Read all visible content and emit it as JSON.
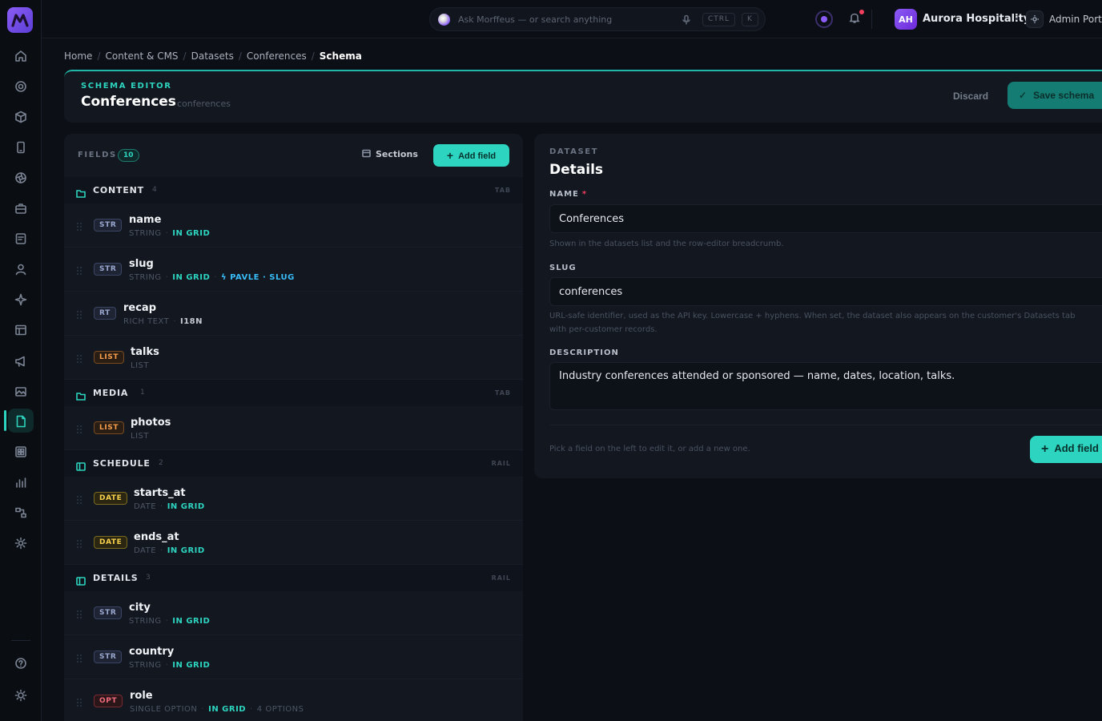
{
  "topbar": {
    "search_placeholder": "Ask Morffeus — or search anything",
    "kbd_ctrl": "CTRL",
    "kbd_k": "K",
    "avatar_initials": "AH",
    "org_name": "Aurora Hospitality",
    "portal_label": "Admin Portal"
  },
  "breadcrumb": [
    "Home",
    "Content & CMS",
    "Datasets",
    "Conferences",
    "Schema"
  ],
  "header": {
    "eyebrow": "SCHEMA EDITOR",
    "title": "Conferences",
    "slug": "conferences",
    "discard_label": "Discard",
    "save_label": "Save schema"
  },
  "fields_panel": {
    "label": "FIELDS",
    "count": "10",
    "sections_label": "Sections",
    "add_label": "Add field",
    "sections": [
      {
        "name": "CONTENT",
        "count": "4",
        "kind": "TAB",
        "fields": [
          {
            "badge": "STR",
            "name": "name",
            "type": "STRING",
            "flags": [
              "IN GRID"
            ]
          },
          {
            "badge": "STR",
            "name": "slug",
            "type": "STRING",
            "flags": [
              "IN GRID",
              "PAVLE · SLUG"
            ]
          },
          {
            "badge": "RT",
            "name": "recap",
            "type": "RICH TEXT",
            "flags": [
              "I18N"
            ]
          },
          {
            "badge": "LIST",
            "name": "talks",
            "type": "LIST",
            "flags": []
          }
        ]
      },
      {
        "name": "MEDIA",
        "count": "1",
        "kind": "TAB",
        "fields": [
          {
            "badge": "LIST",
            "name": "photos",
            "type": "LIST",
            "flags": []
          }
        ]
      },
      {
        "name": "SCHEDULE",
        "count": "2",
        "kind": "RAIL",
        "fields": [
          {
            "badge": "DATE",
            "name": "starts_at",
            "type": "DATE",
            "flags": [
              "IN GRID"
            ]
          },
          {
            "badge": "DATE",
            "name": "ends_at",
            "type": "DATE",
            "flags": [
              "IN GRID"
            ]
          }
        ]
      },
      {
        "name": "DETAILS",
        "count": "3",
        "kind": "RAIL",
        "fields": [
          {
            "badge": "STR",
            "name": "city",
            "type": "STRING",
            "flags": [
              "IN GRID"
            ]
          },
          {
            "badge": "STR",
            "name": "country",
            "type": "STRING",
            "flags": [
              "IN GRID"
            ]
          },
          {
            "badge": "OPT",
            "name": "role",
            "type": "SINGLE OPTION",
            "flags": [
              "IN GRID",
              "4 OPTIONS"
            ]
          }
        ]
      }
    ]
  },
  "details": {
    "eyebrow": "DATASET",
    "title": "Details",
    "name_label": "NAME",
    "name_value": "Conferences",
    "name_help": "Shown in the datasets list and the row-editor breadcrumb.",
    "slug_label": "SLUG",
    "slug_value": "conferences",
    "slug_help_1": "URL-safe identifier, used as the API key. Lowercase + hyphens. When set, the dataset also appears on the customer's Datasets tab",
    "slug_help_2": "with per-customer records.",
    "desc_label": "DESCRIPTION",
    "desc_value": "Industry conferences attended or sponsored — name, dates, location, talks.",
    "hint": "Pick a field on the left to edit it, or add a new one.",
    "add_label": "Add field"
  },
  "colors": {
    "accent": "#2dd4bf",
    "brand": "#8b5cf6",
    "background": "#0c0f15",
    "panel": "#121720"
  }
}
